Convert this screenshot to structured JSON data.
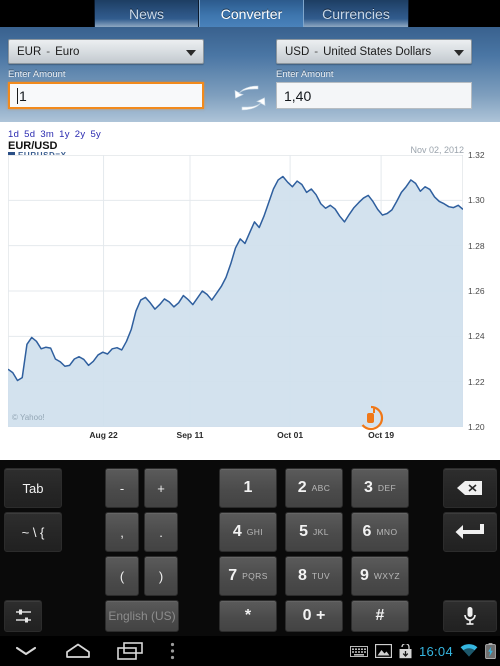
{
  "tabs": [
    {
      "label": "News",
      "active": false
    },
    {
      "label": "Converter",
      "active": true
    },
    {
      "label": "Currencies",
      "active": false
    }
  ],
  "converter": {
    "source": {
      "code": "EUR",
      "separator": "-",
      "name": "Euro",
      "amount_label": "Enter Amount",
      "amount_value": "1",
      "focused": true
    },
    "target": {
      "code": "USD",
      "separator": "-",
      "name": "United States Dollars",
      "amount_label": "Enter Amount",
      "amount_value": "1,40",
      "focused": false
    },
    "swap_icon": "swap-arrows-icon",
    "focus_color": "#f28a1c"
  },
  "chart_data": {
    "type": "area",
    "title": "EUR/USD",
    "subtitle": "EURUSD=X",
    "date_label": "Nov 02, 2012",
    "watermark": "© Yahoo!",
    "ranges": [
      "1d",
      "5d",
      "3m",
      "1y",
      "2y",
      "5y"
    ],
    "selected_range": "3m",
    "xlabel": "",
    "ylabel": "",
    "ylim": [
      1.2,
      1.32
    ],
    "yticks": [
      1.2,
      1.22,
      1.24,
      1.26,
      1.28,
      1.3,
      1.32
    ],
    "xticks": [
      "Aug 22",
      "Sep 11",
      "Oct 01",
      "Oct 19"
    ],
    "xtick_positions": [
      0.21,
      0.4,
      0.62,
      0.82
    ],
    "grid": true,
    "line_color": "#2f5f9e",
    "fill_color": "#cfe0ed",
    "series": [
      {
        "name": "EURUSD=X",
        "values": [
          1.2255,
          1.224,
          1.2205,
          1.2218,
          1.2365,
          1.2395,
          1.2378,
          1.2345,
          1.2352,
          1.2348,
          1.23,
          1.2288,
          1.2268,
          1.2272,
          1.23,
          1.231,
          1.2298,
          1.2272,
          1.229,
          1.2318,
          1.233,
          1.2322,
          1.2345,
          1.235,
          1.234,
          1.2378,
          1.243,
          1.2512,
          1.256,
          1.2572,
          1.2548,
          1.252,
          1.254,
          1.2565,
          1.2552,
          1.253,
          1.2548,
          1.258,
          1.2562,
          1.254,
          1.257,
          1.26,
          1.2585,
          1.256,
          1.259,
          1.262,
          1.266,
          1.272,
          1.279,
          1.283,
          1.281,
          1.2858,
          1.2905,
          1.288,
          1.293,
          1.299,
          1.305,
          1.309,
          1.3105,
          1.308,
          1.306,
          1.3085,
          1.307,
          1.3035,
          1.305,
          1.3025,
          1.2985,
          1.2965,
          1.2978,
          1.2962,
          1.293,
          1.2905,
          1.2938,
          1.2968,
          1.299,
          1.301,
          1.3022,
          1.2995,
          1.296,
          1.2935,
          1.2942,
          1.2958,
          1.2995,
          1.3035,
          1.306,
          1.309,
          1.3075,
          1.304,
          1.306,
          1.3048,
          1.3015,
          1.2995,
          1.2985,
          1.2972,
          1.2968,
          1.2978,
          1.296
        ]
      }
    ]
  },
  "keyboard": {
    "language": "English (US)",
    "keys": {
      "tab": "Tab",
      "symbols": "~ \\ {",
      "minus": "-",
      "plus": "+",
      "comma": ",",
      "period": ".",
      "paren_open": "(",
      "paren_close": ")",
      "star": "*",
      "hash": "#",
      "zero": "0 +"
    },
    "numpad": [
      {
        "digit": "1",
        "letters": ""
      },
      {
        "digit": "2",
        "letters": "ABC"
      },
      {
        "digit": "3",
        "letters": "DEF"
      },
      {
        "digit": "4",
        "letters": "GHI"
      },
      {
        "digit": "5",
        "letters": "JKL"
      },
      {
        "digit": "6",
        "letters": "MNO"
      },
      {
        "digit": "7",
        "letters": "PQRS"
      },
      {
        "digit": "8",
        "letters": "TUV"
      },
      {
        "digit": "9",
        "letters": "WXYZ"
      }
    ],
    "icons": {
      "backspace": "backspace-icon",
      "enter": "enter-icon",
      "microphone": "microphone-icon",
      "settings": "keyboard-settings-icon"
    }
  },
  "systembar": {
    "clock": "16:04",
    "nav": [
      "hide-keyboard-icon",
      "home-icon",
      "recents-icon",
      "menu-icon"
    ],
    "status": [
      "keyboard-icon",
      "screenshot-icon",
      "download-icon",
      "wifi-icon",
      "battery-charging-icon"
    ],
    "accent_color": "#35b6e0"
  }
}
